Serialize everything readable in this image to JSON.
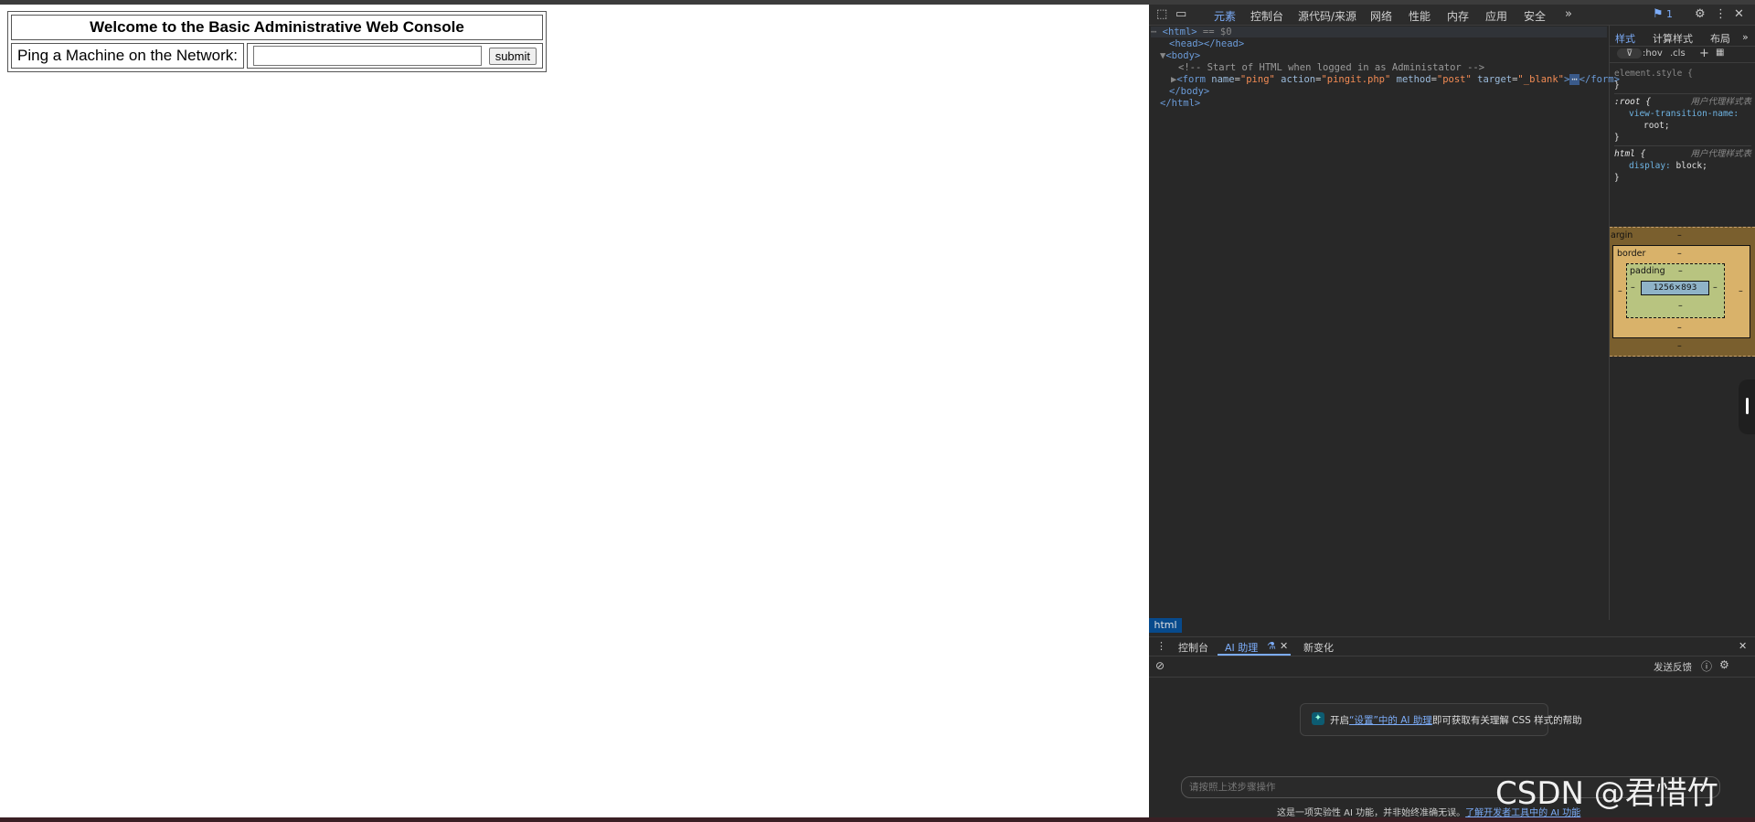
{
  "page": {
    "heading": "Welcome to the Basic Administrative Web Console",
    "ping_label": "Ping a Machine on the Network:",
    "ping_input_value": "",
    "submit_label": "submit"
  },
  "devtools": {
    "tabs": [
      "元素",
      "控制台",
      "源代码/来源",
      "网络",
      "性能",
      "内存",
      "应用",
      "安全"
    ],
    "active_tab": "元素",
    "issues_count": "1",
    "elements": {
      "line_html": "<html>",
      "line_html_marker": "== $0",
      "line_head": "<head></head>",
      "line_body_open": "<body>",
      "line_comment": "<!-- Start of HTML when logged in as Administator -->",
      "form_tag": "form",
      "form_attrs": [
        {
          "name": "name",
          "value": "\"ping\""
        },
        {
          "name": "action",
          "value": "\"pingit.php\""
        },
        {
          "name": "method",
          "value": "\"post\""
        },
        {
          "name": "target",
          "value": "\"_blank\""
        }
      ],
      "form_close": "</form>",
      "line_body_close": "</body>",
      "line_html_close": "</html>",
      "breadcrumb": "html"
    },
    "styles": {
      "tabs": [
        "样式",
        "计算样式",
        "布局"
      ],
      "filter_hov": ":hov",
      "filter_cls": ".cls",
      "element_style": "element.style {",
      "rule_root_selector": ":root {",
      "rule_root_source": "用户代理样式表",
      "rule_root_prop": "view-transition-name:",
      "rule_root_value": "root;",
      "rule_html_selector": "html {",
      "rule_html_source": "用户代理样式表",
      "rule_html_prop": "display:",
      "rule_html_value": "block;",
      "close_brace": "}",
      "box_margin": "argin",
      "box_border": "border",
      "box_padding": "padding",
      "box_content": "1256×893",
      "dash": "–"
    },
    "drawer": {
      "tabs": [
        "控制台",
        "AI 助理",
        "新变化"
      ],
      "active_tab": "AI 助理",
      "feedback": "发送反馈",
      "card_prefix": "开启",
      "card_link": "“设置”中的 AI 助理",
      "card_suffix": "即可获取有关理解 CSS 样式的帮助",
      "input_placeholder": "请按照上述步骤操作",
      "footnote_text": "这是一项实验性 AI 功能，并非始终准确无误。",
      "footnote_link": "了解开发者工具中的 AI 功能"
    }
  },
  "watermark": "CSDN @君惜竹",
  "colors": {
    "devtools_bg": "#282828",
    "accent": "#7cacf8",
    "tag_color": "#6b9bd8",
    "attr_value_color": "#f28b54"
  }
}
